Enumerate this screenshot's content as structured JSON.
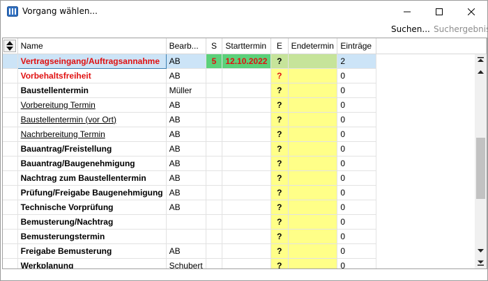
{
  "window": {
    "title": "Vorgang wählen..."
  },
  "toolbar": {
    "search_label": "Suchen...",
    "results_label": "Suchergebnis"
  },
  "grid": {
    "columns": [
      "Name",
      "Bearb...",
      "S",
      "Starttermin",
      "E",
      "Endetermin",
      "Einträge"
    ],
    "rows": [
      {
        "name": "Vertragseingang/Auftragsannahme",
        "bearb": "AB",
        "s": "5",
        "start": "12.10.2022",
        "e": "?",
        "end": "",
        "entries": "2"
      },
      {
        "name": "Vorbehaltsfreiheit",
        "bearb": "AB",
        "s": "",
        "start": "",
        "e": "?",
        "end": "",
        "entries": "0"
      },
      {
        "name": "Baustellentermin",
        "bearb": "Müller",
        "s": "",
        "start": "",
        "e": "?",
        "end": "",
        "entries": "0"
      },
      {
        "name": "Vorbereitung Termin",
        "bearb": "AB",
        "s": "",
        "start": "",
        "e": "?",
        "end": "",
        "entries": "0"
      },
      {
        "name": "Baustellentermin (vor Ort)",
        "bearb": "AB",
        "s": "",
        "start": "",
        "e": "?",
        "end": "",
        "entries": "0"
      },
      {
        "name": "Nachrbereitung Termin",
        "bearb": "AB",
        "s": "",
        "start": "",
        "e": "?",
        "end": "",
        "entries": "0"
      },
      {
        "name": "Bauantrag/Freistellung",
        "bearb": "AB",
        "s": "",
        "start": "",
        "e": "?",
        "end": "",
        "entries": "0"
      },
      {
        "name": "Bauantrag/Baugenehmigung",
        "bearb": "AB",
        "s": "",
        "start": "",
        "e": "?",
        "end": "",
        "entries": "0"
      },
      {
        "name": "Nachtrag zum Baustellentermin",
        "bearb": "AB",
        "s": "",
        "start": "",
        "e": "?",
        "end": "",
        "entries": "0"
      },
      {
        "name": "Prüfung/Freigabe Baugenehmigung",
        "bearb": "AB",
        "s": "",
        "start": "",
        "e": "?",
        "end": "",
        "entries": "0"
      },
      {
        "name": "Technische Vorprüfung",
        "bearb": "AB",
        "s": "",
        "start": "",
        "e": "?",
        "end": "",
        "entries": "0"
      },
      {
        "name": "Bemusterung/Nachtrag",
        "bearb": "",
        "s": "",
        "start": "",
        "e": "?",
        "end": "",
        "entries": "0"
      },
      {
        "name": "Bemusterungstermin",
        "bearb": "",
        "s": "",
        "start": "",
        "e": "?",
        "end": "",
        "entries": "0"
      },
      {
        "name": "Freigabe Bemusterung",
        "bearb": "AB",
        "s": "",
        "start": "",
        "e": "?",
        "end": "",
        "entries": "0"
      },
      {
        "name": "Werkplanung",
        "bearb": "Schubert",
        "s": "",
        "start": "",
        "e": "?",
        "end": "",
        "entries": "0"
      }
    ]
  },
  "colors": {
    "selection": "#cce4f7",
    "status_green": "#5bd17a",
    "highlight_yellow": "#ffff88",
    "alert_red": "#e01010"
  },
  "icons": {
    "app": "grid-app-icon",
    "sort": "sort-updown-icon"
  }
}
